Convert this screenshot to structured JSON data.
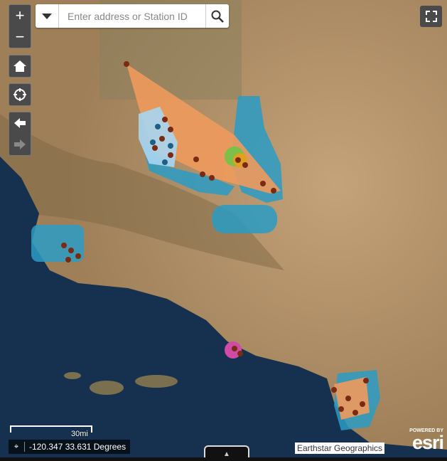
{
  "search": {
    "placeholder": "Enter address or Station ID"
  },
  "controls": {
    "zoom_in": "+",
    "zoom_out": "−",
    "icons": [
      "plus-icon",
      "minus-icon",
      "home-icon",
      "locate-icon",
      "arrow-left-icon",
      "arrow-right-icon",
      "fullscreen-icon",
      "search-icon",
      "chevron-down-icon"
    ]
  },
  "scalebar": {
    "label": "30mi"
  },
  "coordinates": {
    "text": "-120.347 33.631 Degrees"
  },
  "attribution": {
    "text": "Earthstar Geographics"
  },
  "logo": {
    "powered": "POWERED BY",
    "name": "esri"
  },
  "colors": {
    "orange": "#ee9a5c",
    "blue": "#2a9cc4",
    "lightblue": "#a9d6f2",
    "points": "#7a2a10",
    "magenta": "#d04aa8",
    "ocean": "#16314f",
    "land": "#a88a62"
  }
}
